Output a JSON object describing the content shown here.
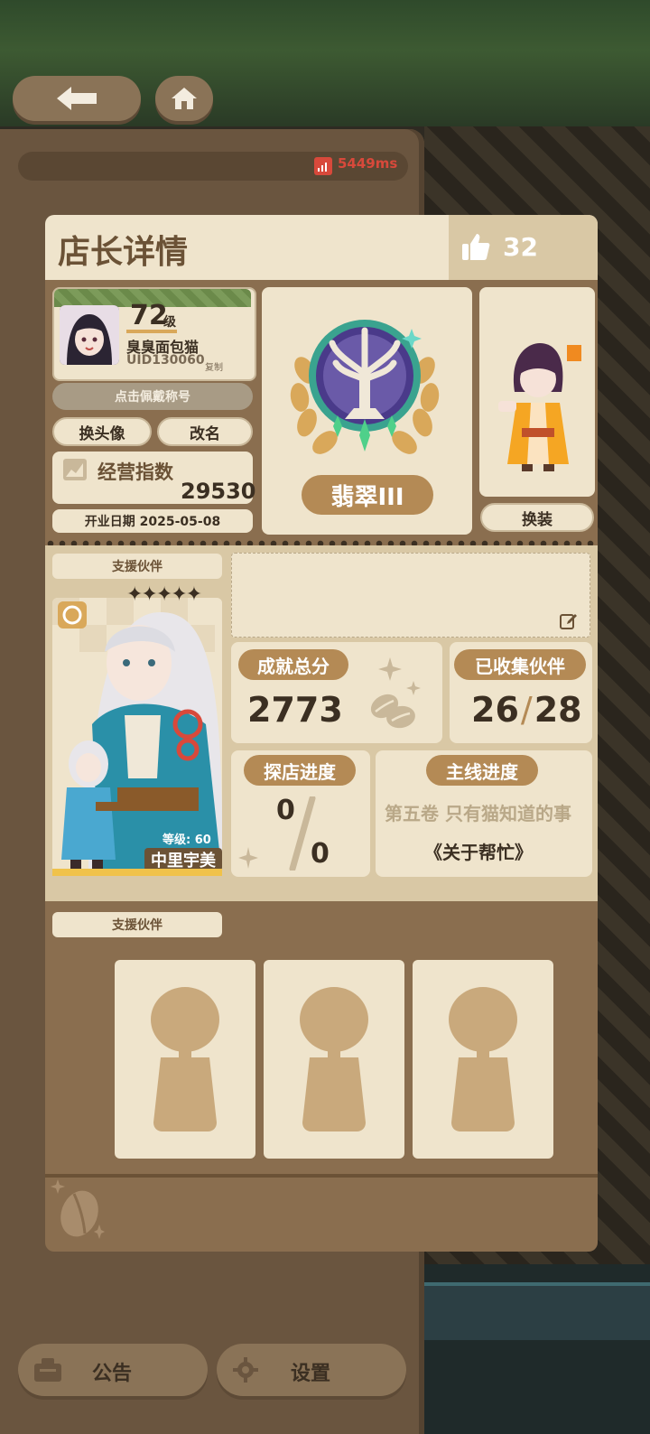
{
  "top_nav": {
    "back_icon": "arrow-left-icon",
    "home_icon": "home-icon"
  },
  "network": {
    "ping": "5449ms",
    "icon": "signal-bars-icon"
  },
  "dialog": {
    "title": "店长详情",
    "likes": "32"
  },
  "profile": {
    "level": "72",
    "level_unit": "级",
    "name": "臭臭面包猫",
    "uid": "UID130060",
    "copy_label": "复制",
    "wear_title_button": "点击佩戴称号",
    "change_avatar_button": "换头像",
    "rename_button": "改名",
    "business_index_label": "经营指数",
    "business_index_value": "29530",
    "open_date": "开业日期 2025-05-08"
  },
  "rank": {
    "label": "翡翠III",
    "icon": "emerald-laurel-tree-emblem"
  },
  "outfit": {
    "button": "换装"
  },
  "support_partner": {
    "label": "支援伙伴",
    "stars": "✦✦✦✦✦",
    "level": "等级: 60",
    "name": "中里宇美"
  },
  "stats": {
    "achievement_label": "成就总分",
    "achievement_value": "2773",
    "collected_label": "已收集伙伴",
    "collected_current": "26",
    "collected_total": "28",
    "explore_label": "探店进度",
    "explore_current": "0",
    "explore_total": "0",
    "story_label": "主线进度",
    "story_volume": "第五卷 只有猫知道的事",
    "story_chapter": "《关于帮忙》"
  },
  "support_slots": {
    "label": "支援伙伴",
    "count": 3
  },
  "bottom_bar": {
    "notice_label": "公告",
    "settings_label": "设置"
  },
  "colors": {
    "panel_cream": "#efe4cc",
    "panel_brown": "#8a6e4f",
    "accent_gold": "#b48a55",
    "ping_red": "#d8493b"
  }
}
